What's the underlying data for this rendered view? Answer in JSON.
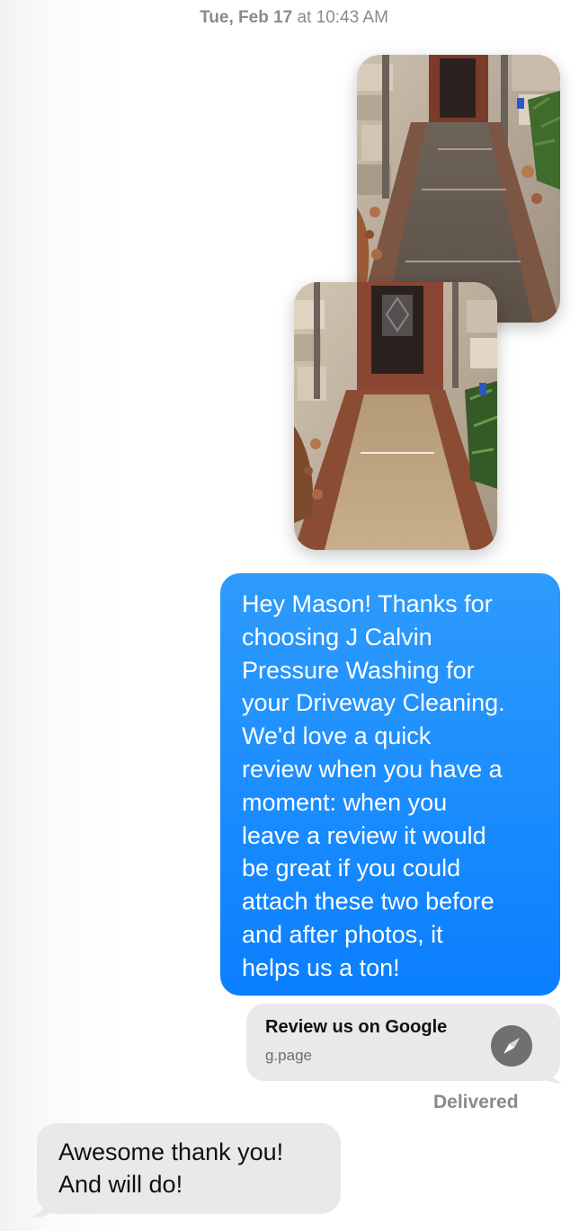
{
  "header": {
    "date": "Tue, Feb 17",
    "time_prefix": " at ",
    "time": "10:43 AM"
  },
  "attachments": [
    {
      "name": "before-photo",
      "kind": "image"
    },
    {
      "name": "after-photo",
      "kind": "image"
    }
  ],
  "sent_message": {
    "text": "Hey Mason! Thanks for\nchoosing J Calvin\nPressure Washing for\nyour Driveway Cleaning.\nWe'd love a quick\nreview when you have a\nmoment: when you\nleave a review it would\nbe great if you could\nattach these two before\nand after photos, it\nhelps us a ton!"
  },
  "link_preview": {
    "title": "Review us on Google",
    "domain": "g.page",
    "icon": "compass-icon"
  },
  "status": {
    "delivered": "Delivered"
  },
  "received_message": {
    "text": "Awesome thank you!\nAnd will do!"
  },
  "colors": {
    "sent_bubble": "#1a8cfe",
    "received_bubble": "#e9e9eb",
    "timestamp": "#8a8a8e"
  }
}
